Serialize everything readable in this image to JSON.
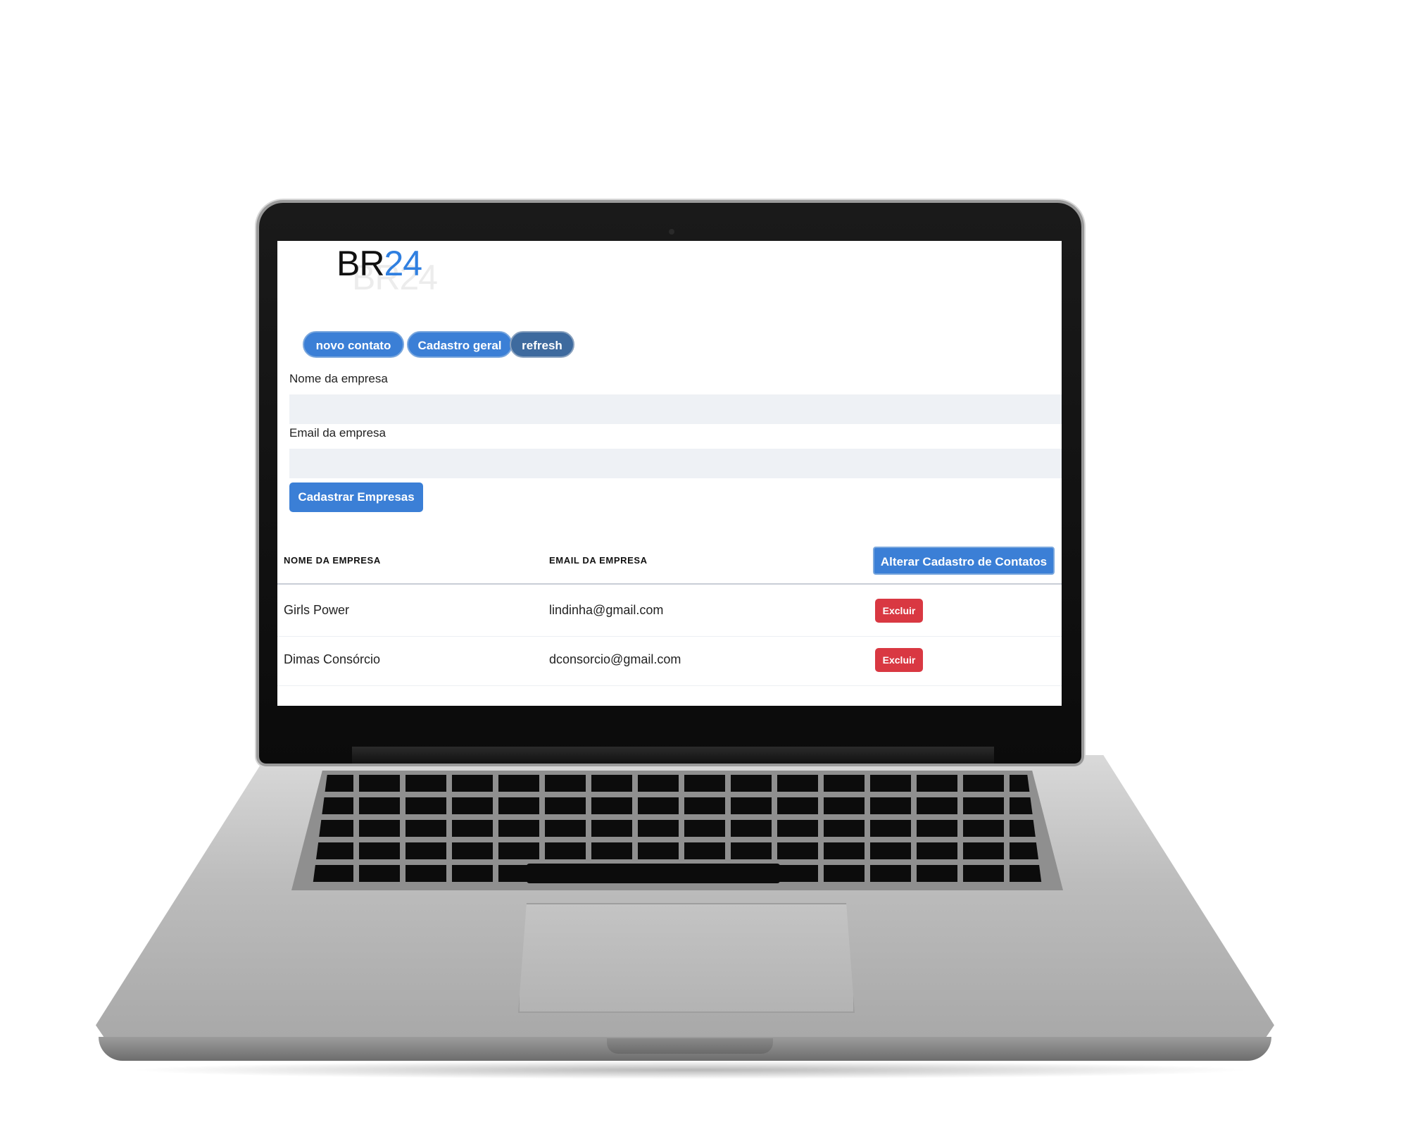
{
  "app": {
    "logo_letters": "BR",
    "logo_digits": "24",
    "logo_shadow": "BR24"
  },
  "toolbar": {
    "new_contact_label": "novo contato",
    "general_register_label": "Cadastro geral",
    "refresh_label": "refresh"
  },
  "form": {
    "company_name_label": "Nome da empresa",
    "company_name_value": "",
    "company_email_label": "Email da empresa",
    "company_email_value": "",
    "submit_label": "Cadastrar Empresas"
  },
  "table": {
    "columns": [
      "NOME DA EMPRESA",
      "EMAIL DA EMPRESA"
    ],
    "alter_button_label": "Alterar Cadastro de Contatos",
    "rows": [
      {
        "name": "Girls Power",
        "email": "lindinha@gmail.com",
        "action": "Excluir"
      },
      {
        "name": "Dimas Consórcio",
        "email": "dconsorcio@gmail.com",
        "action": "Excluir"
      }
    ]
  },
  "colors": {
    "primary": "#3b7fd6",
    "secondary": "#3e6a9e",
    "danger": "#d93842",
    "logo_accent": "#2f7fe0",
    "input_bg": "#eef1f5"
  }
}
